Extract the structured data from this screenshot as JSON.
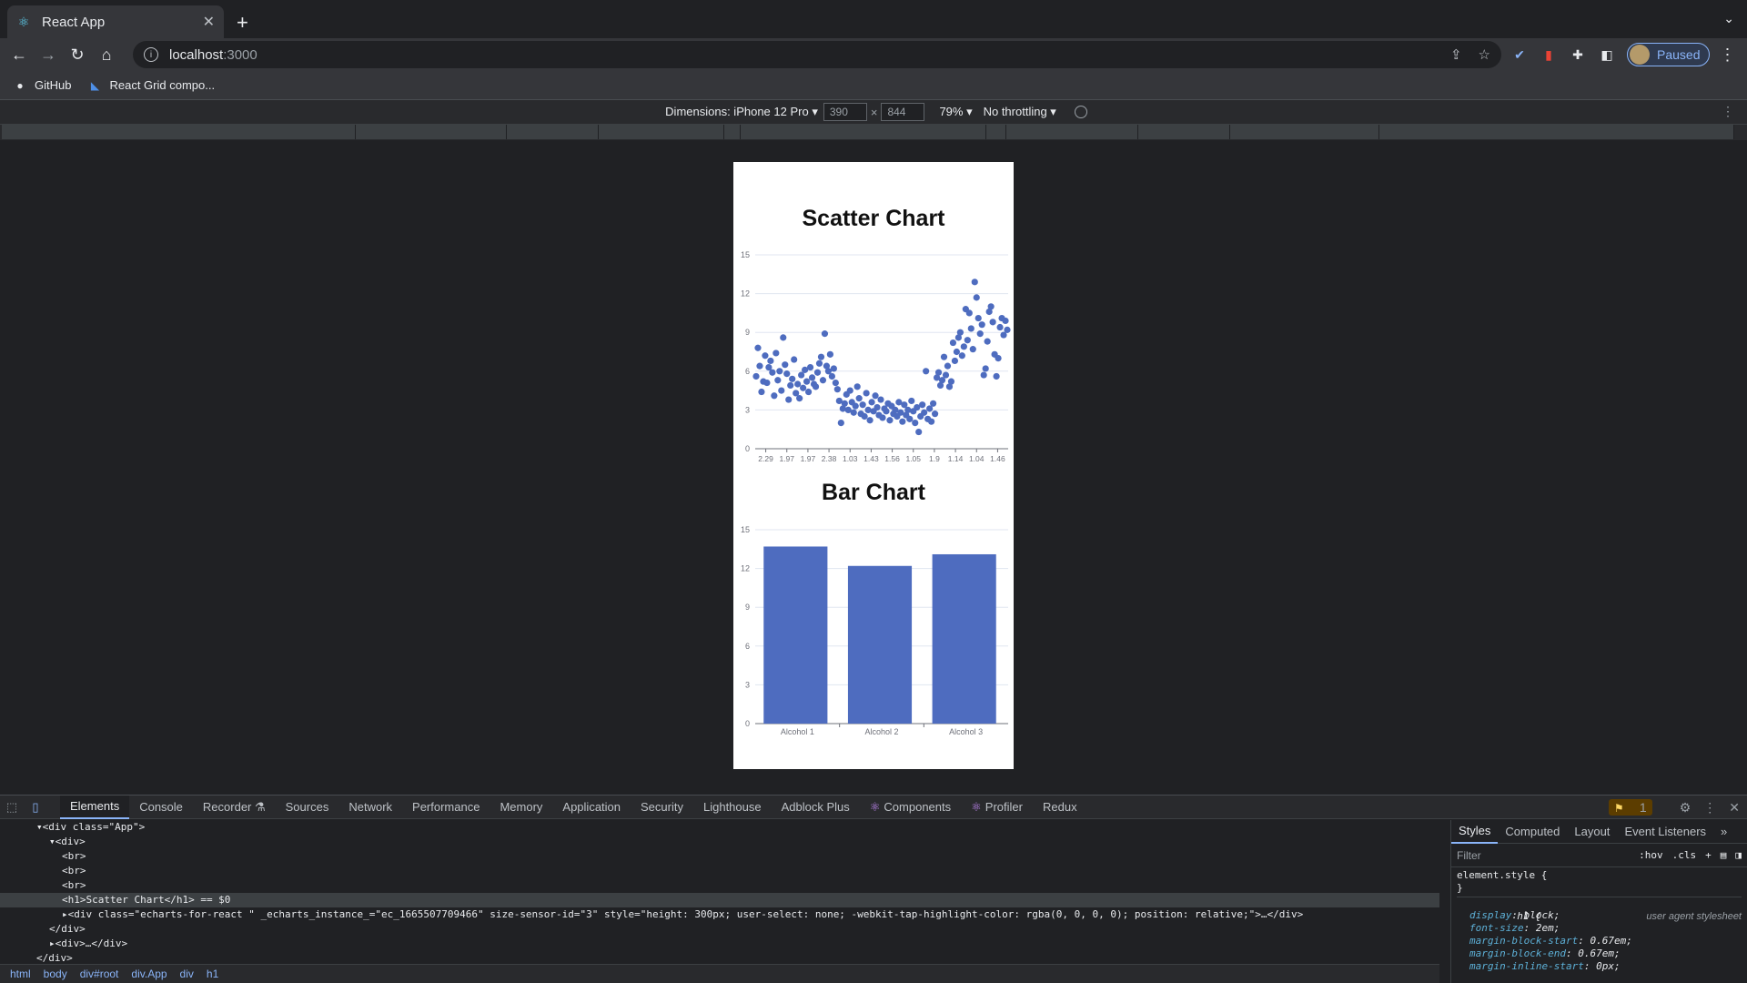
{
  "browser": {
    "tab_title": "React App",
    "url_host": "localhost",
    "url_port": ":3000",
    "profile_label": "Paused",
    "bookmarks": [
      "GitHub",
      "React Grid compo..."
    ]
  },
  "device_toolbar": {
    "dimensions_label": "Dimensions: iPhone 12 Pro ▾",
    "width": "390",
    "height": "844",
    "zoom": "79% ▾",
    "throttling": "No throttling ▾"
  },
  "app": {
    "scatter_title": "Scatter Chart",
    "bar_title": "Bar Chart"
  },
  "chart_data": [
    {
      "type": "scatter",
      "ylim": [
        0,
        15
      ],
      "yticks": [
        "0",
        "3",
        "6",
        "9",
        "12",
        "15"
      ],
      "xticks": [
        "2.29",
        "1.97",
        "1.97",
        "2.38",
        "1.03",
        "1.43",
        "1.56",
        "1.05",
        "1.9",
        "1.14",
        "1.04",
        "1.46"
      ],
      "color": "#4e6cbf",
      "y": [
        5.6,
        7.8,
        6.4,
        4.4,
        5.2,
        7.2,
        5.1,
        6.3,
        6.8,
        5.9,
        4.1,
        7.4,
        5.3,
        6.0,
        4.5,
        8.6,
        6.5,
        5.8,
        3.8,
        4.9,
        5.4,
        6.9,
        4.3,
        5.0,
        3.9,
        5.7,
        4.7,
        6.1,
        5.2,
        4.4,
        6.3,
        5.5,
        5.0,
        4.8,
        5.9,
        6.6,
        7.1,
        5.3,
        8.9,
        6.4,
        6.0,
        7.3,
        5.6,
        6.2,
        5.1,
        4.6,
        3.7,
        2.0,
        3.1,
        3.5,
        4.2,
        3.0,
        4.5,
        3.6,
        2.8,
        3.3,
        4.8,
        3.9,
        2.7,
        3.4,
        2.5,
        4.3,
        3.0,
        2.2,
        3.6,
        2.9,
        4.1,
        3.2,
        2.6,
        3.8,
        2.4,
        3.1,
        2.9,
        3.5,
        2.2,
        3.3,
        2.7,
        3.0,
        2.5,
        3.6,
        2.8,
        2.1,
        3.4,
        2.6,
        3.0,
        2.3,
        3.7,
        2.9,
        2.0,
        3.2,
        1.3,
        2.5,
        3.4,
        2.8,
        6.0,
        2.3,
        3.1,
        2.1,
        3.5,
        2.7,
        5.5,
        5.9,
        4.9,
        5.3,
        7.1,
        5.7,
        6.4,
        4.8,
        5.2,
        8.2,
        6.8,
        7.5,
        8.6,
        9.0,
        7.2,
        7.9,
        10.8,
        8.4,
        10.5,
        9.3,
        7.7,
        12.9,
        11.7,
        10.1,
        8.9,
        9.6,
        5.7,
        6.2,
        8.3,
        10.6,
        11.0,
        9.8,
        7.3,
        5.6,
        7.0,
        9.4,
        10.1,
        8.8,
        9.9,
        9.2
      ]
    },
    {
      "type": "bar",
      "categories": [
        "Alcohol 1",
        "Alcohol 2",
        "Alcohol 3"
      ],
      "values": [
        13.7,
        12.2,
        13.1
      ],
      "ylim": [
        0,
        15
      ],
      "yticks": [
        "0",
        "3",
        "6",
        "9",
        "12",
        "15"
      ],
      "color": "#4e6cbf"
    }
  ],
  "devtools": {
    "tabs": [
      "Elements",
      "Console",
      "Recorder ⚗",
      "Sources",
      "Network",
      "Performance",
      "Memory",
      "Application",
      "Security",
      "Lighthouse",
      "Adblock Plus",
      "Components",
      "Profiler",
      "Redux"
    ],
    "issues_count": "1",
    "dom_lines": [
      {
        "indent": 2,
        "html": "▾<div class=\"App\">"
      },
      {
        "indent": 3,
        "html": "▾<div>"
      },
      {
        "indent": 4,
        "html": "<br>"
      },
      {
        "indent": 4,
        "html": "<br>"
      },
      {
        "indent": 4,
        "html": "<br>"
      },
      {
        "indent": 4,
        "html": "<h1>Scatter Chart</h1> == $0",
        "selected": true
      },
      {
        "indent": 4,
        "html": "▸<div class=\"echarts-for-react \" _echarts_instance_=\"ec_1665507709466\" size-sensor-id=\"3\" style=\"height: 300px; user-select: none; -webkit-tap-highlight-color: rgba(0, 0, 0, 0); position: relative;\">…</div>"
      },
      {
        "indent": 3,
        "html": "</div>"
      },
      {
        "indent": 3,
        "html": "▸<div>…</div>"
      },
      {
        "indent": 2,
        "html": "</div>"
      }
    ],
    "breadcrumbs": [
      "html",
      "body",
      "div#root",
      "div.App",
      "div",
      "h1"
    ],
    "styles_tabs": [
      "Styles",
      "Computed",
      "Layout",
      "Event Listeners",
      "»"
    ],
    "filter_placeholder": "Filter",
    "filter_buttons": [
      ":hov",
      ".cls",
      "+"
    ],
    "element_style": "element.style {",
    "element_style_close": "}",
    "ua_selector": "h1 {",
    "ua_label": "user agent stylesheet",
    "ua_props": [
      {
        "prop": "display",
        "val": "block;"
      },
      {
        "prop": "font-size",
        "val": "2em;"
      },
      {
        "prop": "margin-block-start",
        "val": "0.67em;"
      },
      {
        "prop": "margin-block-end",
        "val": "0.67em;"
      },
      {
        "prop": "margin-inline-start",
        "val": "0px;"
      }
    ]
  }
}
